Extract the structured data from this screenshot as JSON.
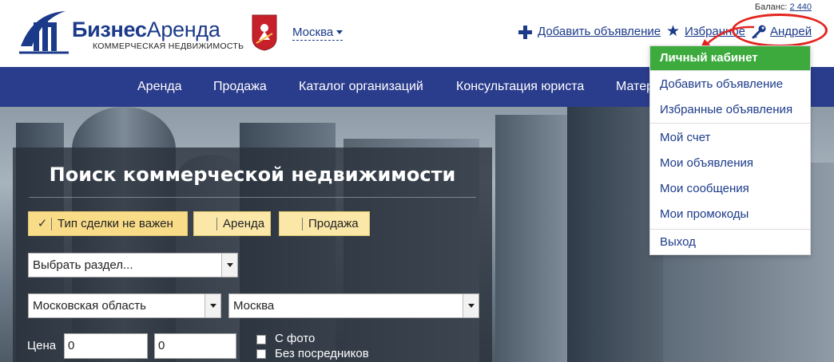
{
  "header": {
    "brand": {
      "word1": "Бизнес",
      "word2": "Аренда",
      "subtitle": "КОММЕРЧЕСКАЯ НЕДВИЖИМОСТЬ"
    },
    "city": "Москва",
    "balance_label": "Баланс:",
    "balance_value": "2 440",
    "add_ad": "Добавить объявление",
    "favorites": "Избранное",
    "user": "Андрей"
  },
  "nav": {
    "items": [
      "Аренда",
      "Продажа",
      "Каталог организаций",
      "Консультация юриста",
      "Материалы"
    ]
  },
  "search": {
    "title": "Поиск коммерческой недвижимости",
    "deal_types": [
      "Тип сделки не важен",
      "Аренда",
      "Продажа"
    ],
    "section_placeholder": "Выбрать раздел...",
    "region": "Московская область",
    "city": "Москва",
    "price_label": "Цена",
    "price_from": "0",
    "price_to": "0",
    "checkboxes": [
      "С фото",
      "Без посредников"
    ]
  },
  "user_menu": {
    "items": [
      "Личный кабинет",
      "Добавить объявление",
      "Избранные объявления",
      "Мой счет",
      "Мои объявления",
      "Мои сообщения",
      "Мои промокоды",
      "Выход"
    ]
  },
  "colors": {
    "brand": "#1b3a8a",
    "nav": "#2a3c8c",
    "active_menu": "#3daa3e",
    "highlight_ring": "#e4241f",
    "deal_button": "#fbe8a8"
  }
}
